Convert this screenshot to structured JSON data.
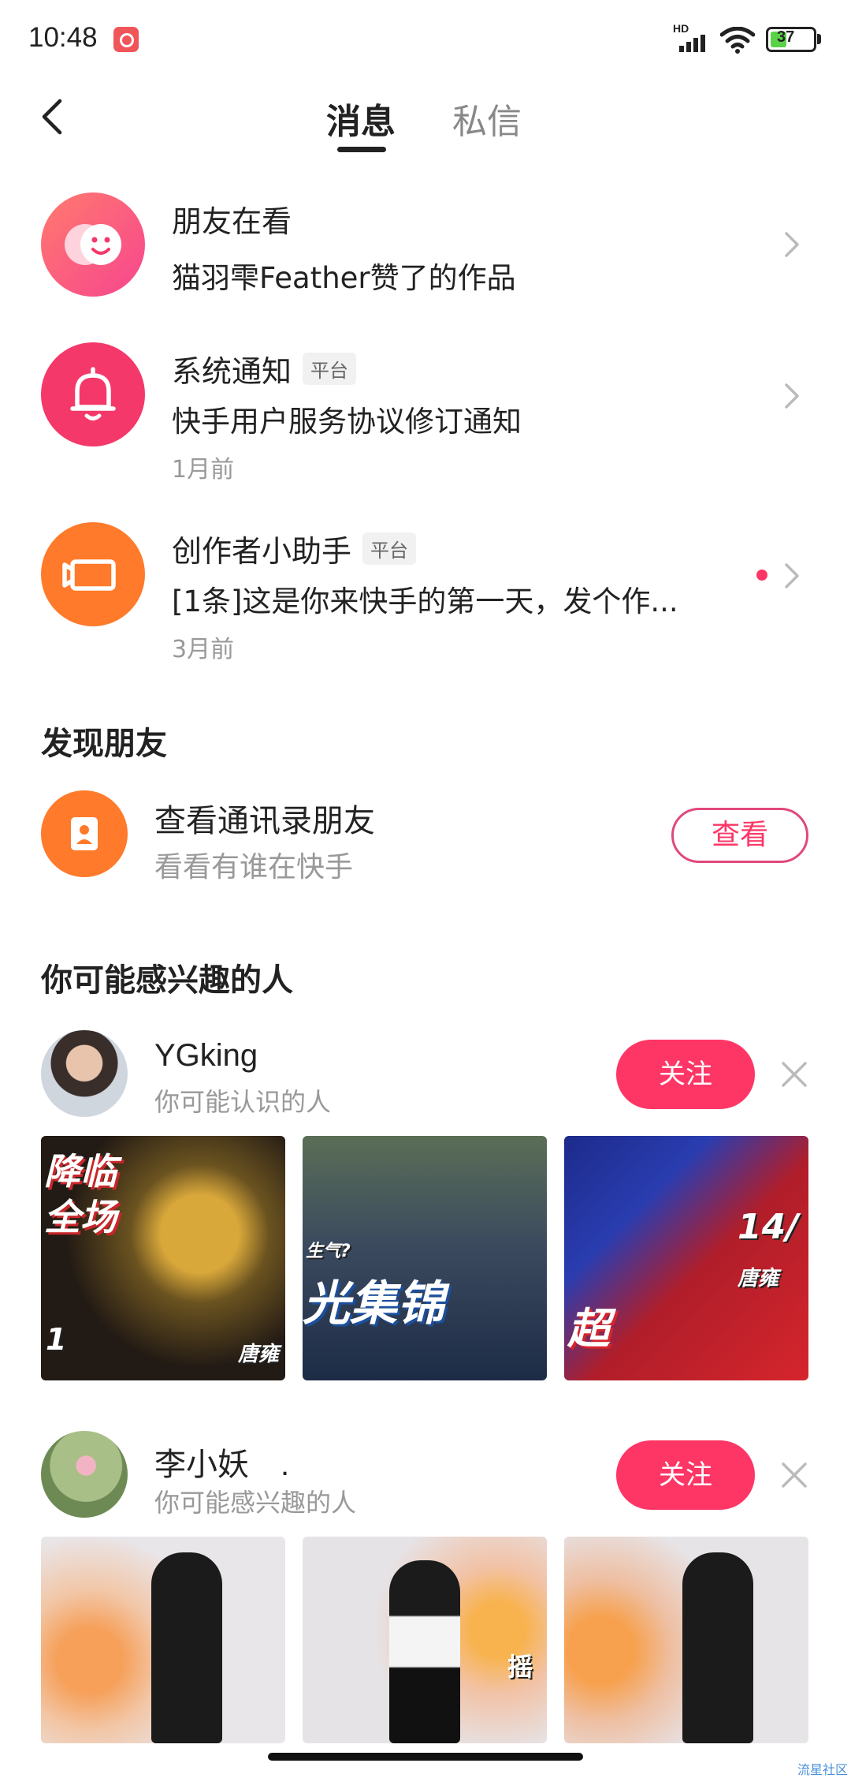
{
  "status_bar": {
    "time": "10:48",
    "network": "HD",
    "battery": "37"
  },
  "header": {
    "tabs": [
      {
        "label": "消息"
      },
      {
        "label": "私信"
      }
    ]
  },
  "messages": [
    {
      "title": "朋友在看",
      "subtitle": "猫羽雫Feather赞了的作品",
      "icon": "friends-smile-icon",
      "color": "#fc5a8a"
    },
    {
      "title": "系统通知",
      "tag": "平台",
      "subtitle": "快手用户服务协议修订通知",
      "time": "1月前",
      "icon": "bell-icon",
      "color": "#f5386a"
    },
    {
      "title": "创作者小助手",
      "tag": "平台",
      "subtitle": "[1条]这是你来快手的第一天，发个作...",
      "time": "3月前",
      "icon": "video-camera-icon",
      "color": "#ff7a2a",
      "unread": true
    }
  ],
  "discover": {
    "section_title": "发现朋友",
    "contacts": {
      "title": "查看通讯录朋友",
      "subtitle": "看看有谁在快手",
      "button": "查看"
    }
  },
  "recommend": {
    "section_title": "你可能感兴趣的人",
    "users": [
      {
        "name": "YGking",
        "reason": "你可能认识的人",
        "follow": "关注",
        "thumbs": [
          {
            "caption": "降临\n全场",
            "tag": "1",
            "tag2": "唐雍"
          },
          {
            "caption": "光集锦",
            "tag": "生气?"
          },
          {
            "caption": "14/",
            "tag": "超",
            "tag2": "唐雍"
          }
        ]
      },
      {
        "name": "李小妖　.",
        "reason": "你可能感兴趣的人",
        "follow": "关注",
        "thumbs": [
          {
            "caption": ""
          },
          {
            "caption": "摇"
          },
          {
            "caption": ""
          }
        ]
      }
    ]
  },
  "watermark": "流星社区",
  "colors": {
    "accent": "#fe3666",
    "orange": "#ff7a2a",
    "pink": "#fc5a8a",
    "text": "#222222",
    "secondary": "#999999"
  }
}
